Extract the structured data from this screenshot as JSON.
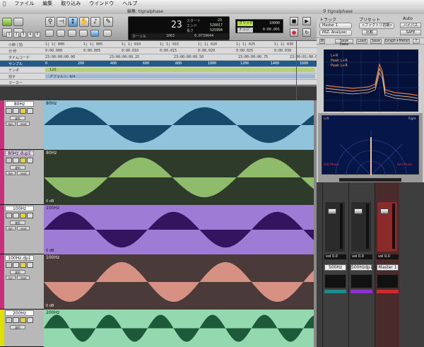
{
  "menu": {
    "items": [
      "ファイル",
      "編集",
      "取り込み",
      "ウインドウ",
      "ヘルプ"
    ]
  },
  "edit_window": {
    "title": "編集: tignalphase"
  },
  "plugin_window": {
    "title": "タ tignalphase",
    "track_label": "トラック",
    "preset_label": "プリセット",
    "auto_label": "Auto",
    "track_value": "Master 1",
    "preset_value": "<ファクトリ初期>",
    "insert_value": "PAZ- Analyzer",
    "compare_label": "比較",
    "safe_label": "SAFE",
    "bypass_label": "バイパス",
    "waves_buttons": [
      "Save Data",
      "Load",
      "Save",
      "Graph+Meter",
      "?"
    ],
    "legend": [
      "L+R",
      "Peak L+R",
      "Peak L+R"
    ],
    "x_ticks": [
      "20",
      "50",
      "100",
      "250",
      "500",
      "1k",
      "2.5k",
      "5k",
      "10k",
      "20k"
    ],
    "scope_left": "Left",
    "scope_right": "Right",
    "scope_anti": "Anti-Phase",
    "scope_meter_ticks": [
      "-40",
      "-20",
      "0"
    ]
  },
  "toolbar": {
    "mode_buttons": [
      "shuffle",
      "slip",
      "spot",
      "grid"
    ],
    "num_buttons": [
      "1",
      "2",
      "3",
      "4",
      "5"
    ],
    "zoom_icon": "zoom-icon",
    "trim_icon": "trim-icon",
    "selector_icon": "selector-icon",
    "grabber_icon": "grabber-icon",
    "pencil_icon": "pencil-icon"
  },
  "counter": {
    "main_value": "23",
    "start_label": "スタート",
    "start_value": "23",
    "end_label": "エンド",
    "end_value": "526017",
    "length_label": "長さ",
    "length_value": "525994",
    "cursor_label": "カーソル",
    "cursor_value": "1063",
    "time_value": "0.0739044"
  },
  "grid": {
    "grid_label": "グリッド",
    "grid_value": "10000",
    "nudge_label": "ナッジ",
    "nudge_value": "0:00.001"
  },
  "rulers": [
    {
      "name": "小節 | 拍",
      "ticks": [
        "1| 1| 000",
        "1| 1| 005",
        "1| 1| 010",
        "1| 1| 015",
        "1| 1| 020",
        "1| 1| 025",
        "1| 1| 030"
      ]
    },
    {
      "name": "分:秒",
      "ticks": [
        "0:00.000",
        "0:00.005",
        "0:00.010",
        "0:00.015",
        "0:00.020",
        "0:00.025",
        "0:00.030"
      ]
    },
    {
      "name": "タイムコード",
      "ticks": [
        "23:00:00:00.00",
        "23:00:00:00.25",
        "23:00:00:00.50",
        "23:00:00:00.75",
        "23:00:01:00.00"
      ]
    },
    {
      "name": "サンプル",
      "ticks": [
        "0",
        "200",
        "400",
        "600",
        "800",
        "1000",
        "1200",
        "1400",
        "1600"
      ]
    },
    {
      "name": "テンポ",
      "band_text": "120"
    },
    {
      "name": "拍子",
      "band_text": "デフォルト: 4/4"
    },
    {
      "name": "マーカー",
      "band_text": ""
    }
  ],
  "tracks": [
    {
      "name": "80Hz",
      "clip": "80Hz",
      "gain": "",
      "head_color": "#c8317a",
      "bg": "#8fc4dc",
      "fg": "#174a6a",
      "cycles": 2.1,
      "phase": 0
    },
    {
      "name": "80Hz.dup1",
      "clip": "80Hz",
      "gain": "0 dB",
      "head_color": "#c8317a",
      "bg": "#2e3a2a",
      "fg": "#8fbc6a",
      "cycles": 2.1,
      "phase": 3.14159
    },
    {
      "name": "100Hz",
      "clip": "100Hz",
      "gain": "0 dB",
      "head_color": "#c8317a",
      "bg": "#9e7bd4",
      "fg": "#34145e",
      "cycles": 2.6,
      "phase": 0
    },
    {
      "name": "100Hz.dp1",
      "clip": "100Hz",
      "gain": "0 dB",
      "head_color": "#c8317a",
      "bg": "#4a3a3a",
      "fg": "#d69182",
      "cycles": 2.6,
      "phase": 3.14159
    },
    {
      "name": "200Hz",
      "clip": "200Hz",
      "gain": "",
      "head_color": "#e0e000",
      "bg": "#94d8b0",
      "fg": "#1c5a3a",
      "cycles": 5.2,
      "phase": 0
    }
  ],
  "track_labels": {
    "waveform": "波形",
    "dyn": "dyn",
    "read": "read"
  },
  "mixer": {
    "strips": [
      {
        "name": "500Hz",
        "vol": "vol",
        "val": "0.0",
        "color": "#1e8a8a",
        "knob": 0.85
      },
      {
        "name": "500Hzdp1",
        "vol": "vol",
        "val": "0.0",
        "color": "#8e2fd0",
        "knob": 0.85
      },
      {
        "name": "Master 1",
        "vol": "vol",
        "val": "0.0",
        "color": "#cc2b2b",
        "knob": 0.85
      }
    ]
  }
}
